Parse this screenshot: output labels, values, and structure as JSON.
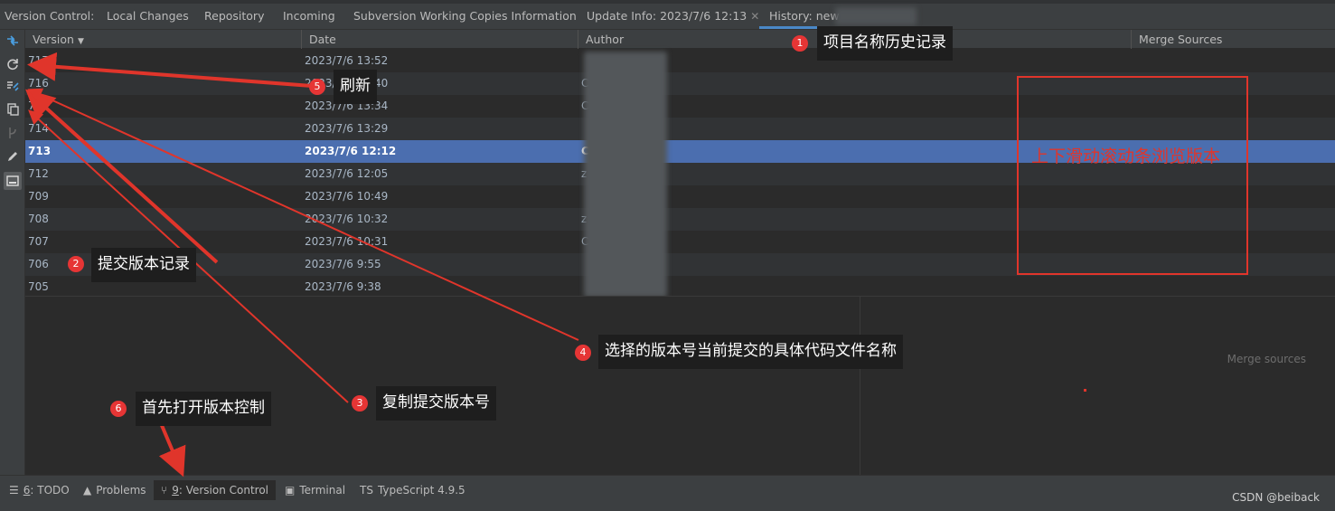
{
  "tabbar": {
    "label": "Version Control:",
    "tabs": [
      {
        "label": "Local Changes"
      },
      {
        "label": "Repository"
      },
      {
        "label": "Incoming"
      },
      {
        "label": "Subversion Working Copies Information"
      },
      {
        "label": "Update Info: 2023/7/6 12:13",
        "closable": true
      },
      {
        "label": "History: new",
        "active": true
      }
    ]
  },
  "table": {
    "columns": [
      "Version",
      "Date",
      "Author",
      "Merge Sources"
    ],
    "rows": [
      {
        "version": "717",
        "date": "2023/7/6 13:52",
        "author": ""
      },
      {
        "version": "716",
        "date": "2023/7/6 13:40",
        "author": "C"
      },
      {
        "version": "715",
        "date": "2023/7/6 13:34",
        "author": "Cl"
      },
      {
        "version": "714",
        "date": "2023/7/6 13:29",
        "author": ""
      },
      {
        "version": "713",
        "date": "2023/7/6 12:12",
        "author": "Chen",
        "selected": true
      },
      {
        "version": "712",
        "date": "2023/7/6 12:05",
        "author": "z"
      },
      {
        "version": "709",
        "date": "2023/7/6 10:49",
        "author": ""
      },
      {
        "version": "708",
        "date": "2023/7/6 10:32",
        "author": "z"
      },
      {
        "version": "707",
        "date": "2023/7/6 10:31",
        "author": "C",
        "author_tail": "ai"
      },
      {
        "version": "706",
        "date": "2023/7/6 9:55",
        "author": ""
      },
      {
        "version": "705",
        "date": "2023/7/6 9:38",
        "author": "",
        "author_tail": "i"
      }
    ]
  },
  "merge_sources_pane": {
    "label": "Merge sources"
  },
  "statusbar": {
    "items": [
      {
        "key": "6",
        "label": ": TODO"
      },
      {
        "label": "Problems"
      },
      {
        "key": "9",
        "label": ": Version Control",
        "active": true
      },
      {
        "label": "Terminal"
      },
      {
        "label": "TypeScript 4.9.5"
      }
    ],
    "watermark": "CSDN @beiback"
  },
  "annotations": {
    "callouts": [
      {
        "num": "1",
        "text": "项目名称历史记录"
      },
      {
        "num": "2",
        "text": "提交版本记录"
      },
      {
        "num": "3",
        "text": "复制提交版本号"
      },
      {
        "num": "4",
        "text": "选择的版本号当前提交的具体代码文件名称"
      },
      {
        "num": "5",
        "text": "刷新"
      },
      {
        "num": "6",
        "text": "首先打开版本控制"
      }
    ],
    "redbox_text": "上下滑动滚动条浏览版本"
  },
  "colors": {
    "accent": "#4b6eaf",
    "annotation_red": "#e0352b",
    "badge_red": "#e63535"
  }
}
